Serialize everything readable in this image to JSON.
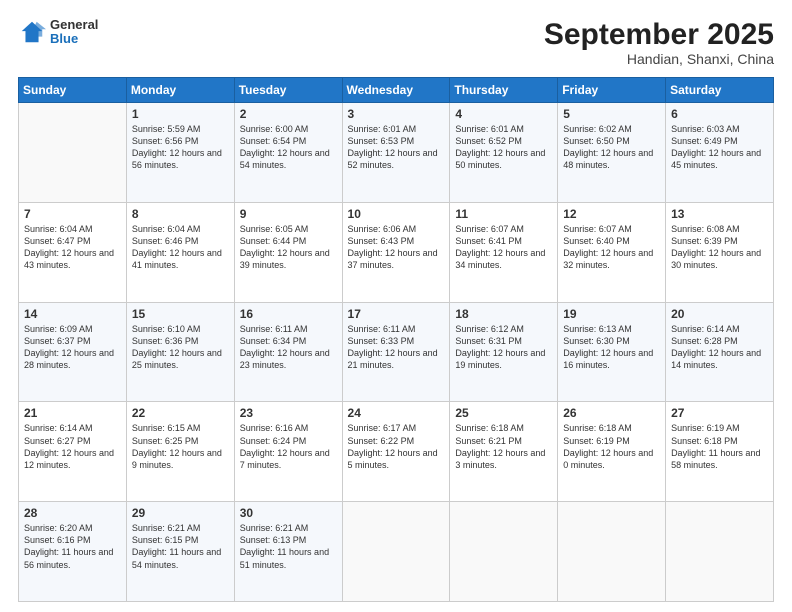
{
  "header": {
    "logo_general": "General",
    "logo_blue": "Blue",
    "month_title": "September 2025",
    "location": "Handian, Shanxi, China"
  },
  "days_of_week": [
    "Sunday",
    "Monday",
    "Tuesday",
    "Wednesday",
    "Thursday",
    "Friday",
    "Saturday"
  ],
  "weeks": [
    [
      {
        "day": "",
        "sunrise": "",
        "sunset": "",
        "daylight": ""
      },
      {
        "day": "1",
        "sunrise": "Sunrise: 5:59 AM",
        "sunset": "Sunset: 6:56 PM",
        "daylight": "Daylight: 12 hours and 56 minutes."
      },
      {
        "day": "2",
        "sunrise": "Sunrise: 6:00 AM",
        "sunset": "Sunset: 6:54 PM",
        "daylight": "Daylight: 12 hours and 54 minutes."
      },
      {
        "day": "3",
        "sunrise": "Sunrise: 6:01 AM",
        "sunset": "Sunset: 6:53 PM",
        "daylight": "Daylight: 12 hours and 52 minutes."
      },
      {
        "day": "4",
        "sunrise": "Sunrise: 6:01 AM",
        "sunset": "Sunset: 6:52 PM",
        "daylight": "Daylight: 12 hours and 50 minutes."
      },
      {
        "day": "5",
        "sunrise": "Sunrise: 6:02 AM",
        "sunset": "Sunset: 6:50 PM",
        "daylight": "Daylight: 12 hours and 48 minutes."
      },
      {
        "day": "6",
        "sunrise": "Sunrise: 6:03 AM",
        "sunset": "Sunset: 6:49 PM",
        "daylight": "Daylight: 12 hours and 45 minutes."
      }
    ],
    [
      {
        "day": "7",
        "sunrise": "Sunrise: 6:04 AM",
        "sunset": "Sunset: 6:47 PM",
        "daylight": "Daylight: 12 hours and 43 minutes."
      },
      {
        "day": "8",
        "sunrise": "Sunrise: 6:04 AM",
        "sunset": "Sunset: 6:46 PM",
        "daylight": "Daylight: 12 hours and 41 minutes."
      },
      {
        "day": "9",
        "sunrise": "Sunrise: 6:05 AM",
        "sunset": "Sunset: 6:44 PM",
        "daylight": "Daylight: 12 hours and 39 minutes."
      },
      {
        "day": "10",
        "sunrise": "Sunrise: 6:06 AM",
        "sunset": "Sunset: 6:43 PM",
        "daylight": "Daylight: 12 hours and 37 minutes."
      },
      {
        "day": "11",
        "sunrise": "Sunrise: 6:07 AM",
        "sunset": "Sunset: 6:41 PM",
        "daylight": "Daylight: 12 hours and 34 minutes."
      },
      {
        "day": "12",
        "sunrise": "Sunrise: 6:07 AM",
        "sunset": "Sunset: 6:40 PM",
        "daylight": "Daylight: 12 hours and 32 minutes."
      },
      {
        "day": "13",
        "sunrise": "Sunrise: 6:08 AM",
        "sunset": "Sunset: 6:39 PM",
        "daylight": "Daylight: 12 hours and 30 minutes."
      }
    ],
    [
      {
        "day": "14",
        "sunrise": "Sunrise: 6:09 AM",
        "sunset": "Sunset: 6:37 PM",
        "daylight": "Daylight: 12 hours and 28 minutes."
      },
      {
        "day": "15",
        "sunrise": "Sunrise: 6:10 AM",
        "sunset": "Sunset: 6:36 PM",
        "daylight": "Daylight: 12 hours and 25 minutes."
      },
      {
        "day": "16",
        "sunrise": "Sunrise: 6:11 AM",
        "sunset": "Sunset: 6:34 PM",
        "daylight": "Daylight: 12 hours and 23 minutes."
      },
      {
        "day": "17",
        "sunrise": "Sunrise: 6:11 AM",
        "sunset": "Sunset: 6:33 PM",
        "daylight": "Daylight: 12 hours and 21 minutes."
      },
      {
        "day": "18",
        "sunrise": "Sunrise: 6:12 AM",
        "sunset": "Sunset: 6:31 PM",
        "daylight": "Daylight: 12 hours and 19 minutes."
      },
      {
        "day": "19",
        "sunrise": "Sunrise: 6:13 AM",
        "sunset": "Sunset: 6:30 PM",
        "daylight": "Daylight: 12 hours and 16 minutes."
      },
      {
        "day": "20",
        "sunrise": "Sunrise: 6:14 AM",
        "sunset": "Sunset: 6:28 PM",
        "daylight": "Daylight: 12 hours and 14 minutes."
      }
    ],
    [
      {
        "day": "21",
        "sunrise": "Sunrise: 6:14 AM",
        "sunset": "Sunset: 6:27 PM",
        "daylight": "Daylight: 12 hours and 12 minutes."
      },
      {
        "day": "22",
        "sunrise": "Sunrise: 6:15 AM",
        "sunset": "Sunset: 6:25 PM",
        "daylight": "Daylight: 12 hours and 9 minutes."
      },
      {
        "day": "23",
        "sunrise": "Sunrise: 6:16 AM",
        "sunset": "Sunset: 6:24 PM",
        "daylight": "Daylight: 12 hours and 7 minutes."
      },
      {
        "day": "24",
        "sunrise": "Sunrise: 6:17 AM",
        "sunset": "Sunset: 6:22 PM",
        "daylight": "Daylight: 12 hours and 5 minutes."
      },
      {
        "day": "25",
        "sunrise": "Sunrise: 6:18 AM",
        "sunset": "Sunset: 6:21 PM",
        "daylight": "Daylight: 12 hours and 3 minutes."
      },
      {
        "day": "26",
        "sunrise": "Sunrise: 6:18 AM",
        "sunset": "Sunset: 6:19 PM",
        "daylight": "Daylight: 12 hours and 0 minutes."
      },
      {
        "day": "27",
        "sunrise": "Sunrise: 6:19 AM",
        "sunset": "Sunset: 6:18 PM",
        "daylight": "Daylight: 11 hours and 58 minutes."
      }
    ],
    [
      {
        "day": "28",
        "sunrise": "Sunrise: 6:20 AM",
        "sunset": "Sunset: 6:16 PM",
        "daylight": "Daylight: 11 hours and 56 minutes."
      },
      {
        "day": "29",
        "sunrise": "Sunrise: 6:21 AM",
        "sunset": "Sunset: 6:15 PM",
        "daylight": "Daylight: 11 hours and 54 minutes."
      },
      {
        "day": "30",
        "sunrise": "Sunrise: 6:21 AM",
        "sunset": "Sunset: 6:13 PM",
        "daylight": "Daylight: 11 hours and 51 minutes."
      },
      {
        "day": "",
        "sunrise": "",
        "sunset": "",
        "daylight": ""
      },
      {
        "day": "",
        "sunrise": "",
        "sunset": "",
        "daylight": ""
      },
      {
        "day": "",
        "sunrise": "",
        "sunset": "",
        "daylight": ""
      },
      {
        "day": "",
        "sunrise": "",
        "sunset": "",
        "daylight": ""
      }
    ]
  ]
}
